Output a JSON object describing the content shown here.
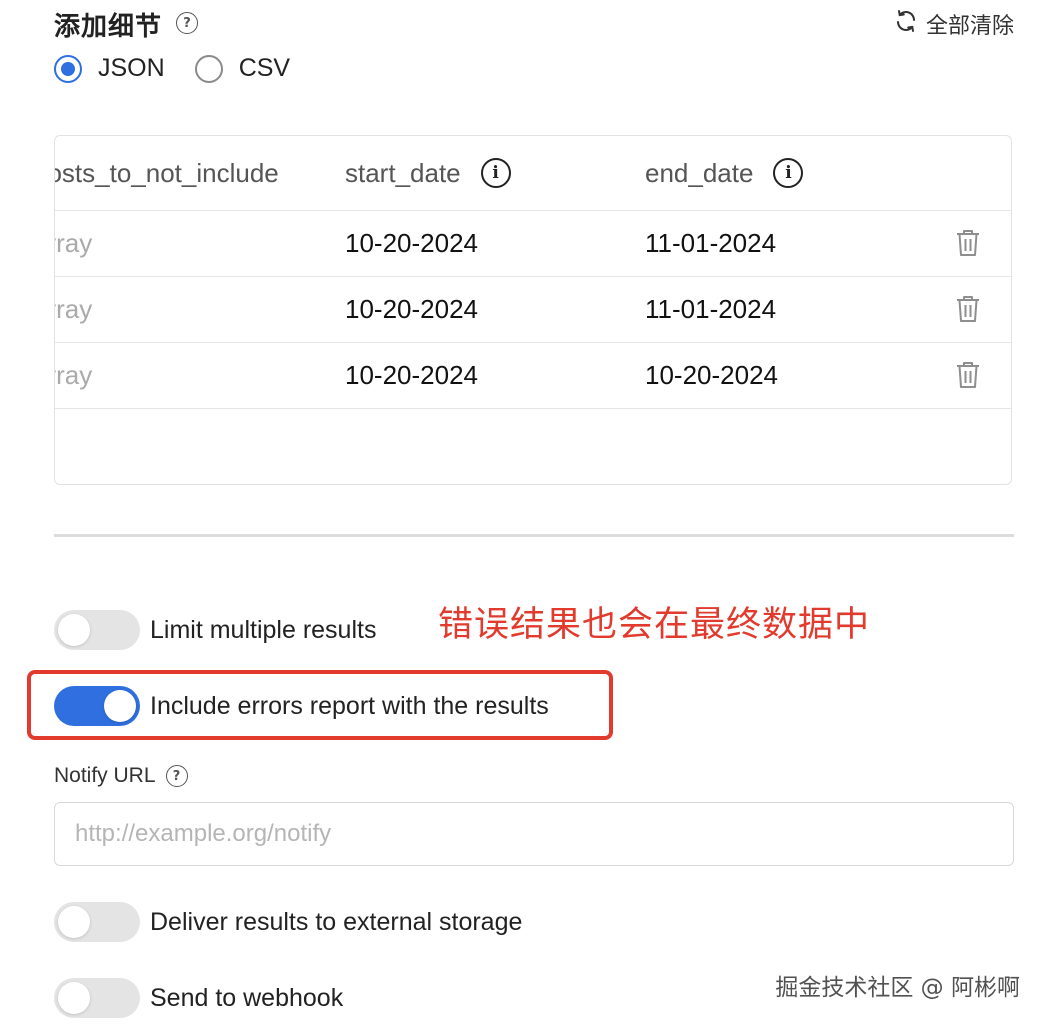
{
  "header": {
    "title": "添加细节",
    "help_glyph": "?",
    "clear_all_label": "全部清除"
  },
  "format": {
    "options": [
      {
        "label": "JSON",
        "checked": true
      },
      {
        "label": "CSV",
        "checked": false
      }
    ]
  },
  "table": {
    "headers": [
      "posts_to_not_include",
      "start_date",
      "end_date"
    ],
    "info_glyph": "i",
    "rows": [
      {
        "col1": "array",
        "start_date": "10-20-2024",
        "end_date": "11-01-2024"
      },
      {
        "col1": "array",
        "start_date": "10-20-2024",
        "end_date": "11-01-2024"
      },
      {
        "col1": "array",
        "start_date": "10-20-2024",
        "end_date": "10-20-2024"
      }
    ]
  },
  "toggles": {
    "limit_multiple": {
      "label": "Limit multiple results",
      "on": false
    },
    "include_errors": {
      "label": "Include errors report with the results",
      "on": true
    },
    "external_storage": {
      "label": "Deliver results to external storage",
      "on": false
    },
    "webhook": {
      "label": "Send to webhook",
      "on": false
    }
  },
  "annotation": {
    "note": "错误结果也会在最终数据中",
    "color": "#e23a2c"
  },
  "notify": {
    "label": "Notify URL",
    "placeholder": "http://example.org/notify",
    "value": ""
  },
  "watermark": "掘金技术社区 @ 阿彬啊",
  "colors": {
    "accent": "#2f6fe0",
    "annotation": "#e23a2c"
  }
}
